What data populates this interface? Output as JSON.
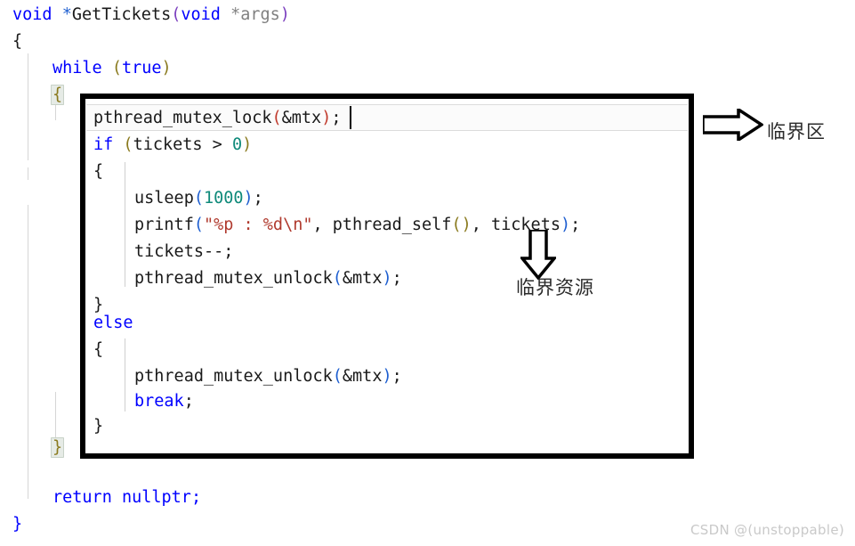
{
  "editor": {
    "language": "cpp",
    "outer_lines": [
      {
        "id": "l1",
        "text": "void *GetTickets(void *args)"
      },
      {
        "id": "l2",
        "text": "{"
      },
      {
        "id": "l3",
        "text": "while (true)"
      },
      {
        "id": "l4",
        "text": "{"
      },
      {
        "id": "l5",
        "text": "}"
      },
      {
        "id": "l6",
        "text": "return nullptr;"
      },
      {
        "id": "l7",
        "text": "}"
      }
    ],
    "box_lines": [
      {
        "id": "b1",
        "text": "pthread_mutex_lock(&mtx);"
      },
      {
        "id": "b2",
        "text": "if (tickets > 0)"
      },
      {
        "id": "b3",
        "text": "{"
      },
      {
        "id": "b4",
        "text": "usleep(1000);"
      },
      {
        "id": "b5",
        "text": "printf(\"%p : %d\\n\", pthread_self(), tickets);"
      },
      {
        "id": "b6",
        "text": "tickets--;"
      },
      {
        "id": "b7",
        "text": "pthread_mutex_unlock(&mtx);"
      },
      {
        "id": "b8",
        "text": "}"
      },
      {
        "id": "b9",
        "text": "else"
      },
      {
        "id": "b10",
        "text": "{"
      },
      {
        "id": "b11",
        "text": "pthread_mutex_unlock(&mtx);"
      },
      {
        "id": "b12",
        "text": "break;"
      },
      {
        "id": "b13",
        "text": "}"
      }
    ],
    "tokens": {
      "void": "void",
      "star": "*",
      "fn_name": "GetTickets",
      "lparen": "(",
      "rparen": ")",
      "args": "args",
      "while": "while",
      "true": "true",
      "if": "if",
      "else": "else",
      "break": "break",
      "return": "return",
      "nullptr": "nullptr",
      "open_brace": "{",
      "close_brace": "}",
      "semicolon": ";",
      "pthread_mutex_lock": "pthread_mutex_lock",
      "pthread_mutex_unlock": "pthread_mutex_unlock",
      "pthread_self": "pthread_self",
      "mtx_ref": "&mtx",
      "tickets": "tickets",
      "gt": ">",
      "zero": "0",
      "usleep": "usleep",
      "thousand": "1000",
      "printf": "printf",
      "format_string": "\"%p : %d\\n\"",
      "comma": ",",
      "decrement": "--"
    },
    "current_line_text": "pthread_mutex_lock(&mtx);"
  },
  "annotations": {
    "critical_section": {
      "label": "临界区",
      "arrow": "arrow-right"
    },
    "critical_resource": {
      "label": "临界资源",
      "arrow": "arrow-down"
    }
  },
  "watermark": {
    "text": "CSDN @(unstoppable)"
  },
  "colors": {
    "keyword": "#0000ff",
    "string": "#b03a2e",
    "number": "#0f8a7a",
    "identifier": "#1a1a1a",
    "parameter": "#808080",
    "paren_violet": "#7b3fbf",
    "paren_blue": "#1f5fd0",
    "paren_olive": "#8a7a1e",
    "paren_red": "#c0392b",
    "box_border": "#000000",
    "annotation_text": "#2b2b2b",
    "watermark": "#c9c9c9",
    "background": "#ffffff"
  }
}
